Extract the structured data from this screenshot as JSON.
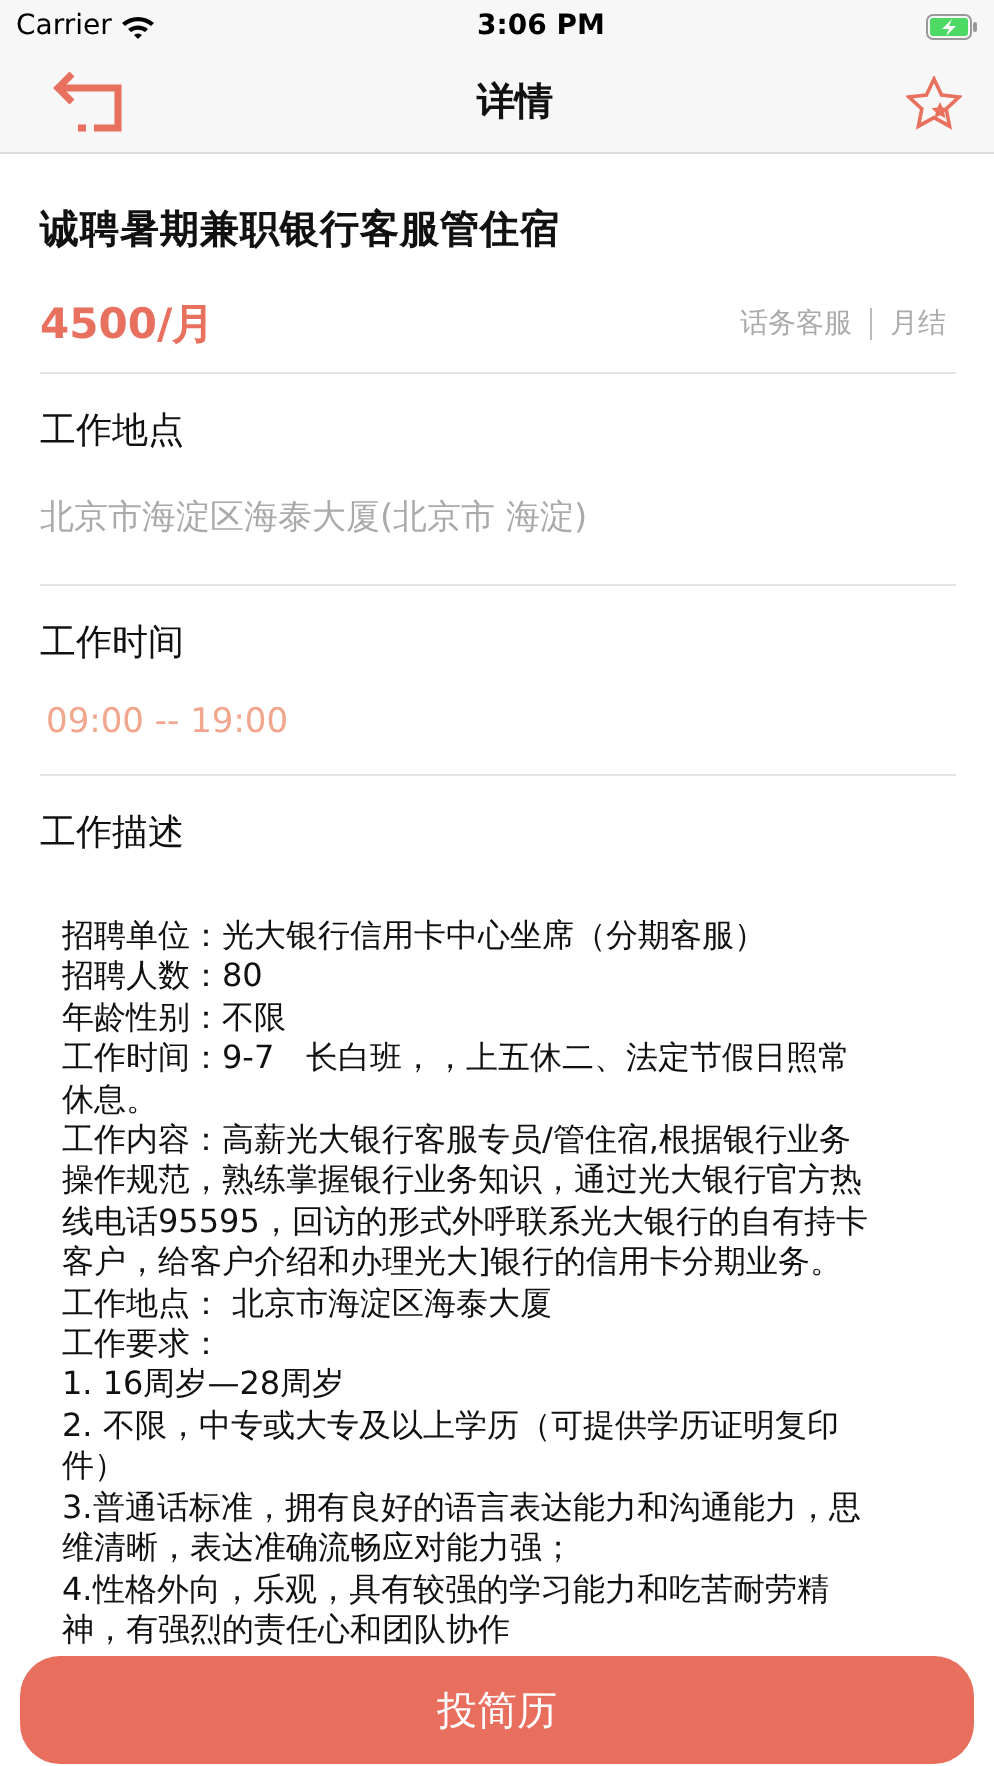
{
  "status_bar": {
    "carrier": "Carrier",
    "time": "3:06 PM"
  },
  "nav": {
    "title": "详情",
    "favorite": false
  },
  "job": {
    "title": "诚聘暑期兼职银行客服管住宿",
    "salary": "4500/月",
    "tags": [
      "话务客服",
      "月结"
    ]
  },
  "sections": [
    {
      "kind": "address",
      "heading": "工作地点",
      "value": "北京市海淀区海泰大厦(北京市 海淀)"
    },
    {
      "kind": "time",
      "heading": "工作时间",
      "value": "09:00 -- 19:00"
    },
    {
      "kind": "description",
      "heading": "工作描述",
      "lines": [
        "招聘单位：光大银行信用卡中心坐席（分期客服）",
        "招聘人数：80",
        "年龄性别：不限",
        "工作时间：9-7　长白班，，上五休二、法定节假日照常",
        "休息。",
        "工作内容：高薪光大银行客服专员/管住宿,根据银行业务",
        "操作规范，熟练掌握银行业务知识，通过光大银行官方热",
        "线电话95595，回访的形式外呼联系光大银行的自有持卡",
        "客户，给客户介绍和办理光大]银行的信用卡分期业务。",
        "工作地点：  北京市海淀区海泰大厦",
        "工作要求：",
        "1. 16周岁—28周岁",
        "2. 不限，中专或大专及以上学历（可提供学历证明复印",
        "件）",
        "3.普通话标准，拥有良好的语言表达能力和沟通能力，思",
        "维清晰，表达准确流畅应对能力强；",
        "4.性格外向，乐观，具有较强的学习能力和吃苦耐劳精",
        "神，有强烈的责任心和团队协作"
      ]
    }
  ],
  "apply_button": "投简历"
}
